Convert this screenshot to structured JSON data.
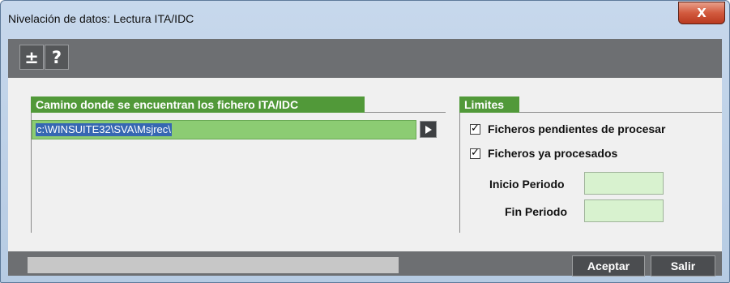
{
  "window": {
    "title": "Nivelación de datos: Lectura ITA/IDC",
    "close_symbol": "X"
  },
  "toolbar": {
    "plus_minus_symbol": "±",
    "help_symbol": "?"
  },
  "path_section": {
    "label": "Camino donde se encuentran los fichero ITA/IDC",
    "value": "c:\\WINSUITE32\\SVA\\Msjrec\\"
  },
  "limits_section": {
    "label": "Limites",
    "pending_label": "Ficheros pendientes de procesar",
    "pending_checked": true,
    "processed_label": "Ficheros ya procesados",
    "processed_checked": true,
    "start_label": "Inicio Periodo",
    "start_value": "",
    "end_label": "Fin Periodo",
    "end_value": ""
  },
  "footer": {
    "status_text": "",
    "accept_label": "Aceptar",
    "exit_label": "Salir"
  },
  "check_glyph": "✓"
}
